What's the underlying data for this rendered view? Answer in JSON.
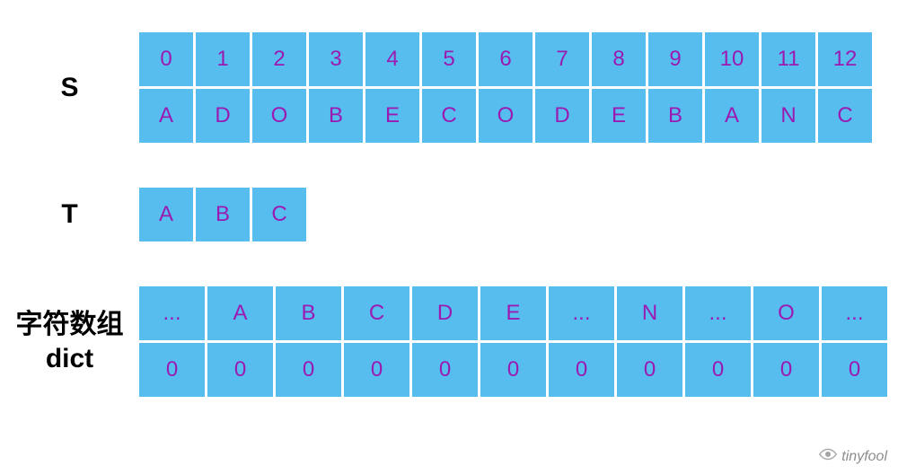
{
  "s": {
    "label": "S",
    "indices": [
      "0",
      "1",
      "2",
      "3",
      "4",
      "5",
      "6",
      "7",
      "8",
      "9",
      "10",
      "11",
      "12"
    ],
    "chars": [
      "A",
      "D",
      "O",
      "B",
      "E",
      "C",
      "O",
      "D",
      "E",
      "B",
      "A",
      "N",
      "C"
    ]
  },
  "t": {
    "label": "T",
    "chars": [
      "A",
      "B",
      "C"
    ]
  },
  "dict": {
    "label_line1": "字符数组",
    "label_line2": "dict",
    "keys": [
      "...",
      "A",
      "B",
      "C",
      "D",
      "E",
      "...",
      "N",
      "...",
      "O",
      "..."
    ],
    "values": [
      "0",
      "0",
      "0",
      "0",
      "0",
      "0",
      "0",
      "0",
      "0",
      "0",
      "0"
    ]
  },
  "watermark": {
    "text": "tinyfool"
  }
}
